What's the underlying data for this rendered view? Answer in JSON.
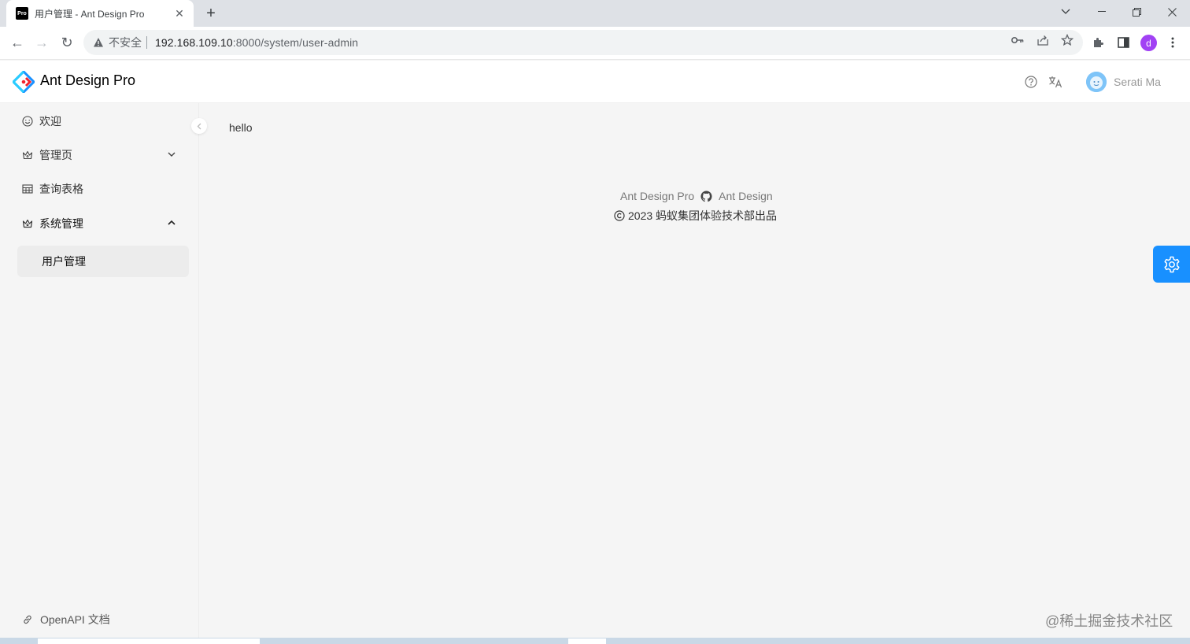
{
  "browser": {
    "tab": {
      "favicon_text": "Pro",
      "title": "用户管理 - Ant Design Pro",
      "close": "✕"
    },
    "new_tab": "+",
    "window_controls": {
      "dropdown": "⌄",
      "minimize": "—",
      "restore": "❐",
      "close": "✕"
    },
    "nav": {
      "back": "←",
      "forward": "→",
      "reload": "↻"
    },
    "address": {
      "security_label": "不安全",
      "host": "192.168.109.10",
      "port_path": ":8000/system/user-admin"
    },
    "profile_initial": "d"
  },
  "header": {
    "title": "Ant Design Pro",
    "username": "Serati Ma"
  },
  "sidebar": {
    "items": [
      {
        "label": "欢迎",
        "icon": "smile-icon"
      },
      {
        "label": "管理页",
        "icon": "crown-icon",
        "expanded": false
      },
      {
        "label": "查询表格",
        "icon": "table-icon"
      },
      {
        "label": "系统管理",
        "icon": "crown-icon",
        "expanded": true
      },
      {
        "label": "用户管理",
        "selected": true
      }
    ],
    "bottom_link": "OpenAPI 文档"
  },
  "content": {
    "text": "hello"
  },
  "footer": {
    "link1": "Ant Design Pro",
    "link2": "Ant Design",
    "copyright": "2023 蚂蚁集团体验技术部出品"
  },
  "watermark": "@稀土掘金技术社区",
  "colors": {
    "primary": "#1890ff",
    "sidebar_bg": "#f5f5f5",
    "selected_bg": "#ececec"
  }
}
